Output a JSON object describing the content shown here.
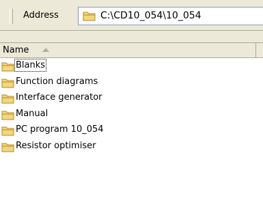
{
  "address_bar": {
    "label": "Address",
    "path": "C:\\CD10_054\\10_054"
  },
  "list": {
    "columns": [
      {
        "label": "Name",
        "sort": "ascending"
      }
    ],
    "items": [
      {
        "label": "Blanks",
        "icon": "folder-icon",
        "focused": true
      },
      {
        "label": "Function diagrams",
        "icon": "folder-icon"
      },
      {
        "label": "Interface generator",
        "icon": "folder-icon"
      },
      {
        "label": "Manual",
        "icon": "folder-icon"
      },
      {
        "label": "PC program 10_054",
        "icon": "folder-icon"
      },
      {
        "label": "Resistor optimiser",
        "icon": "folder-icon"
      }
    ]
  },
  "colors": {
    "toolbar_bg": "#ece9d8",
    "folder_fill": "#f5d67a",
    "folder_stroke": "#b08a2a"
  }
}
